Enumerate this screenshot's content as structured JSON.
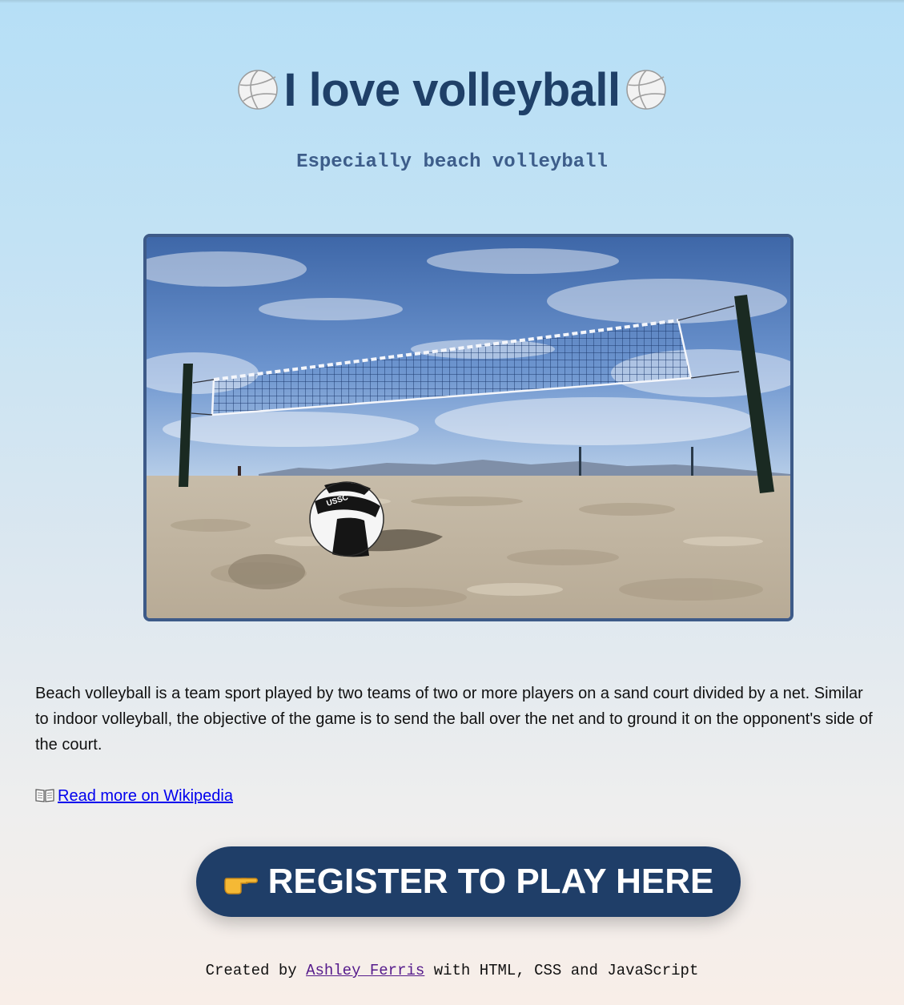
{
  "header": {
    "title": "I love volleyball",
    "subtitle": "Especially beach volleyball"
  },
  "image": {
    "ball_text": "USSC"
  },
  "content": {
    "description": "Beach volleyball is a team sport played by two teams of two or more players on a sand court divided by a net. Similar to indoor volleyball, the objective of the game is to send the ball over the net and to ground it on the opponent's side of the court.",
    "wiki_link": "Read more on Wikipedia"
  },
  "cta": {
    "label": "REGISTER TO PLAY HERE"
  },
  "footer": {
    "prefix": "Created by",
    "author": "Ashley Ferris",
    "suffix": "with HTML, CSS and JavaScript"
  },
  "colors": {
    "heading": "#1f4068",
    "subtitle": "#3d5d8a",
    "button_bg": "#1f3e68",
    "link": "#0000ee",
    "visited_link": "#551a8b"
  },
  "icons": [
    "volleyball-icon",
    "book-icon",
    "pointing-hand-icon"
  ]
}
